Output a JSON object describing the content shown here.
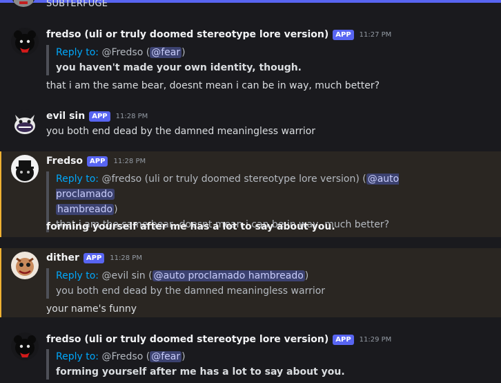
{
  "top": {
    "label": "SUBTERFUGE"
  },
  "colors": {
    "accent": "#5865f2",
    "highlight_bar": "#f0b232",
    "link": "#00a8fc",
    "background": "#1a1a1e"
  },
  "messages": [
    {
      "author": "fredso (uli or truly doomed stereotype lore version)",
      "badge": "APP",
      "time": "11:27 PM",
      "avatar_icon": "shadow-bear-avatar",
      "reply_label": "Reply to:",
      "reply_user": "@Fredso (",
      "reply_mention": "@fear",
      "reply_close": ")",
      "quote_text": "you haven't made your own identity, though.",
      "body": "that i am the same bear, doesnt mean i can be in way, much better?"
    },
    {
      "author": "evil sin",
      "badge": "APP",
      "time": "11:28 PM",
      "avatar_icon": "grinning-creature-avatar",
      "body": "you both end dead by the damned meaningless warrior"
    },
    {
      "author": "Fredso",
      "badge": "APP",
      "time": "11:28 PM",
      "avatar_icon": "hat-bear-avatar",
      "reply_label": "Reply to:",
      "reply_user": "@fredso (uli or truly doomed stereotype lore version) (",
      "reply_mention_1": "@auto proclamado",
      "reply_mention_2": "hambreado",
      "reply_close": ")",
      "quote_text": "that i am the same bear, doesnt mean i can be in way, much better?",
      "body": "forming yourself after me has a lot to say about you."
    },
    {
      "author": "dither",
      "badge": "APP",
      "time": "11:28 PM",
      "avatar_icon": "puppet-avatar",
      "reply_label": "Reply to:",
      "reply_user": "@evil sin (",
      "reply_mention": "@auto proclamado hambreado",
      "reply_close": ")",
      "quote_text": "you both end dead by the damned meaningless warrior",
      "body": "your name's funny"
    },
    {
      "author": "fredso (uli or truly doomed stereotype lore version)",
      "badge": "APP",
      "time": "11:29 PM",
      "avatar_icon": "shadow-bear-avatar",
      "reply_label": "Reply to:",
      "reply_user": "@Fredso (",
      "reply_mention": "@fear",
      "reply_close": ")",
      "quote_text": "forming yourself after me has a lot to say about you."
    }
  ]
}
